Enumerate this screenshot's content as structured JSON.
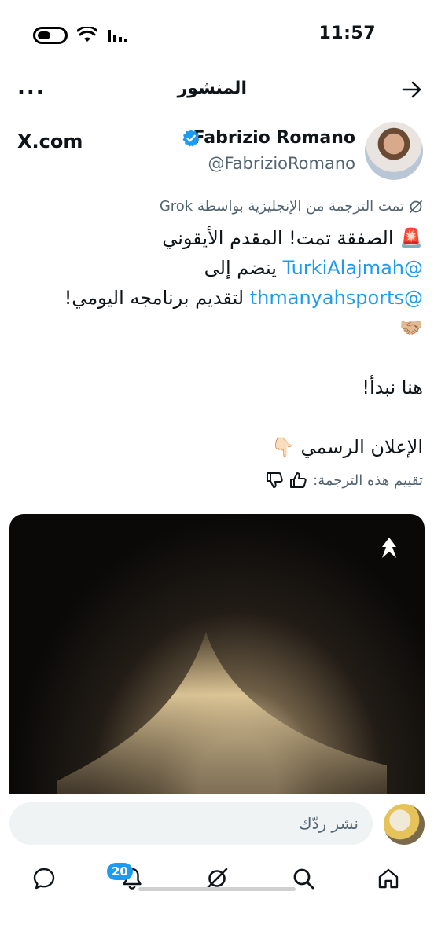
{
  "status_bar": {
    "time": "11:57",
    "battery_level": 0.5
  },
  "header": {
    "title": "المنشور",
    "more_label": "..."
  },
  "author": {
    "name": "Fabrizio Romano",
    "handle": "@FabrizioRomano",
    "source": "X.com",
    "verified_color": "#1d9bf0"
  },
  "post": {
    "translation_note": "تمت الترجمة من الإنجليزية بواسطة Grok",
    "line1": "🚨 الصفقة تمت! المقدم الأيقوني",
    "mention1": "@TurkiAlajmah",
    "line2_rest": " ينضم إلى",
    "mention2": "@thmanyahsports",
    "line3_rest": " لتقديم برنامجه اليومي!",
    "line4": "🤝🏼",
    "line5": "هنا نبدأ!",
    "line6": "الإعلان الرسمي 👇🏻",
    "rate_label": "تقييم هذه الترجمة:"
  },
  "reply": {
    "placeholder": "نشر ردّك"
  },
  "nav": {
    "notifications_count": "20"
  },
  "colors": {
    "accent": "#1d9bf0",
    "text": "#0f1419",
    "muted": "#536471"
  }
}
